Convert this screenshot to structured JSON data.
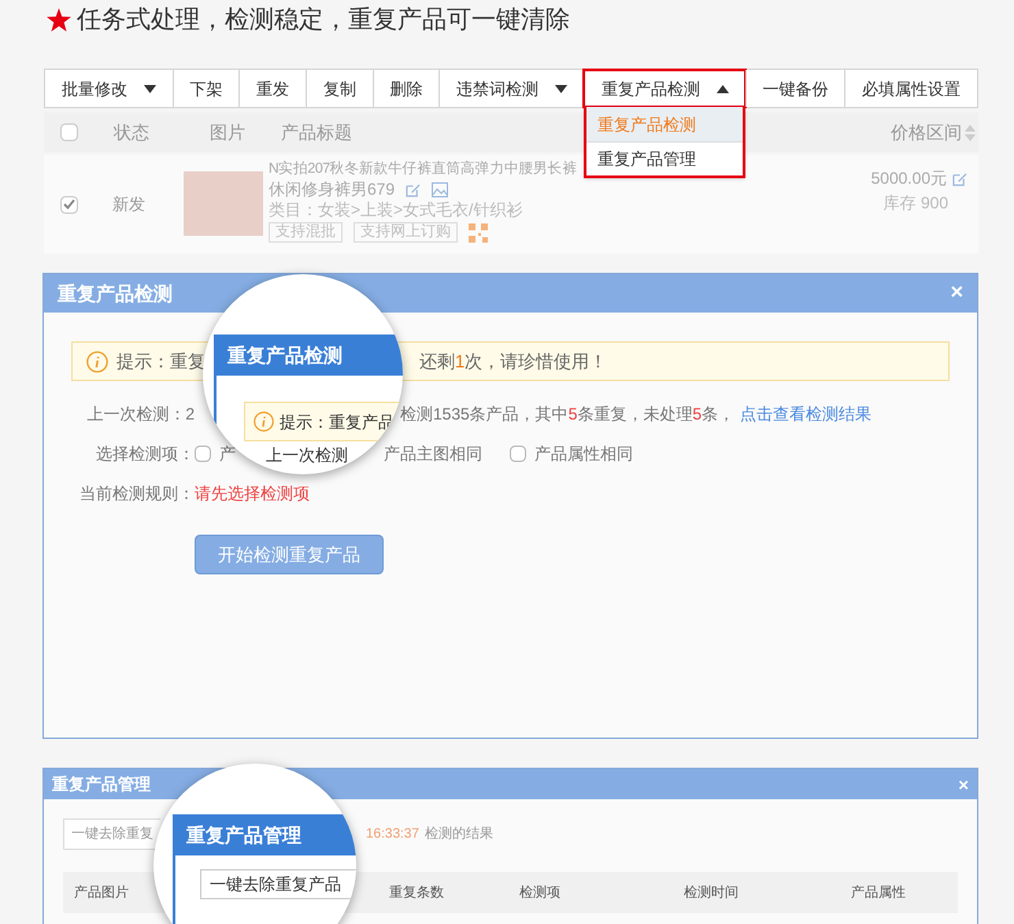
{
  "headline": {
    "text": "任务式处理，检测稳定，重复产品可一键清除"
  },
  "toolbar": [
    {
      "label": "批量修改",
      "kind": "dropdown",
      "expanded": false
    },
    {
      "label": "下架",
      "kind": "button"
    },
    {
      "label": "重发",
      "kind": "button"
    },
    {
      "label": "复制",
      "kind": "button"
    },
    {
      "label": "删除",
      "kind": "button"
    },
    {
      "label": "违禁词检测",
      "kind": "dropdown",
      "expanded": false
    },
    {
      "label": "重复产品检测",
      "kind": "dropdown",
      "expanded": true,
      "menu": [
        {
          "label": "重复产品检测",
          "selected": true
        },
        {
          "label": "重复产品管理",
          "selected": false
        }
      ]
    },
    {
      "label": "一键备份",
      "kind": "button"
    },
    {
      "label": "必填属性设置",
      "kind": "button"
    }
  ],
  "product_table": {
    "all_checked": false,
    "columns": [
      "状态",
      "图片",
      "产品标题",
      "价格区间"
    ],
    "rows": [
      {
        "checked": true,
        "status": "新发",
        "title": "N实拍207秋冬新款牛仔裤直筒高弹力中腰男长裤",
        "title_line2": "休闲修身裤男679",
        "category": "类目：女装>上装>女式毛衣/针织衫",
        "tags": [
          "支持混批",
          "支持网上订购"
        ],
        "price": "5000.00元",
        "stock": "库存 900"
      }
    ]
  },
  "detect_panel": {
    "title": "重复产品检测",
    "close": "×",
    "tip_start": "提示：重复",
    "tip_end": [
      {
        "text": "还剩",
        "highlight": false
      },
      {
        "text": "1",
        "highlight": true
      },
      {
        "text": "次，请珍惜使用！",
        "highlight": false
      }
    ],
    "last_label": "上一次检测：2",
    "last_text": [
      {
        "text": "检测1535条产品，其中",
        "highlight": false
      },
      {
        "text": "5",
        "highlight": true
      },
      {
        "text": "条重复，未处理",
        "highlight": false
      },
      {
        "text": "5",
        "highlight": true
      },
      {
        "text": "条，",
        "highlight": false
      }
    ],
    "last_link": "点击查看检测结果",
    "options_label": "选择检测项：",
    "options": [
      {
        "label": "产",
        "checked": false
      },
      {
        "label": "产品主图相同"
      },
      {
        "label": "产品属性相同",
        "checked": false
      }
    ],
    "rule_label": "当前检测规则：",
    "rule_value": "请先选择检测项",
    "start_button": "开始检测重复产品",
    "magnifier": {
      "title": "重复产品检测",
      "tip": "提示：重复产品",
      "line": "上一次检测"
    }
  },
  "manage_panel": {
    "title": "重复产品管理",
    "close": "×",
    "action_button": "一键去除重复",
    "time": "16:33:37",
    "result_text": "检测的结果",
    "columns": [
      "产品图片",
      "重复条数",
      "检测项",
      "检测时间",
      "产品属性"
    ],
    "magnifier": {
      "title": "重复产品管理",
      "button": "一键去除重复产品"
    }
  }
}
